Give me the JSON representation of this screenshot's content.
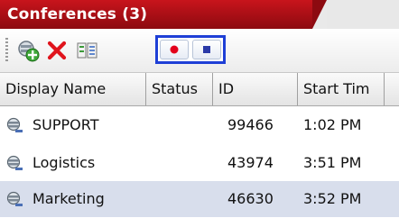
{
  "panel": {
    "title": "Conferences (3)"
  },
  "toolbar": {
    "buttons": [
      {
        "name": "add-conference",
        "icon": "add-conference-icon"
      },
      {
        "name": "delete",
        "icon": "delete-x-icon"
      },
      {
        "name": "settings",
        "icon": "conference-settings-icon"
      }
    ],
    "record_group": {
      "record_icon": "record-dot-icon",
      "stop_icon": "stop-square-icon"
    }
  },
  "table": {
    "columns": [
      "Display Name",
      "Status",
      "ID",
      "Start Tim"
    ],
    "rows": [
      {
        "display_name": "SUPPORT",
        "status": "",
        "id": "99466",
        "start_time": "1:02 PM",
        "selected": false
      },
      {
        "display_name": "Logistics",
        "status": "",
        "id": "43974",
        "start_time": "3:51 PM",
        "selected": false
      },
      {
        "display_name": "Marketing",
        "status": "",
        "id": "46630",
        "start_time": "3:52 PM",
        "selected": true
      }
    ]
  },
  "colors": {
    "title_bar": "#c8141c",
    "record": "#e3001b",
    "stop": "#2b3aa8",
    "highlight_border": "#1e3fd6",
    "selected_row": "#d8deec"
  }
}
